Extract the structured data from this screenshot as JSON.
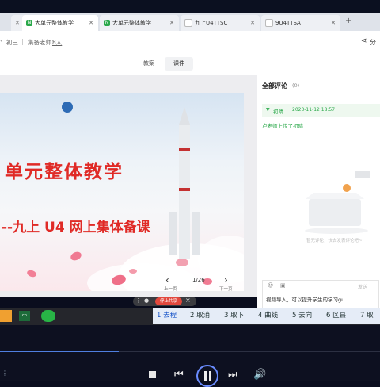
{
  "tabs": [
    {
      "label": "大单元整体教学",
      "active": true
    },
    {
      "label": "大单元整体教学",
      "active": false
    },
    {
      "label": "九上U4TTSC",
      "active": false
    },
    {
      "label": "9U4TTSA",
      "active": false
    }
  ],
  "toolbar": {
    "grade": "初三",
    "teacher_label": "集备老师：",
    "teacher_value": "8人",
    "share_label": "分"
  },
  "view_tabs": [
    "教案",
    "课件"
  ],
  "slide": {
    "title_line1": "单元整体教学",
    "title_line2": "--九上 U4 网上集体备课",
    "page_indicator": "1/26",
    "prev_label": "上一页",
    "next_label": "下一页",
    "record_label": "停止共享"
  },
  "comments": {
    "header": "全部评论",
    "count": "(0)",
    "entry_user": "初晴",
    "entry_time": "2023-11-12 18:57",
    "entry_text": "卢老师上传了初晴",
    "empty_hint": "暂无评论，快去发表评论吧~",
    "input_text": "视频导入，可以提升学生的学习gu",
    "input_hint": "发送"
  },
  "ime_candidates": [
    "1 去程",
    "2 取消",
    "3 取下",
    "4 曲线",
    "5 去向",
    "6 区县",
    "7 取"
  ],
  "colors": {
    "accent": "#2aa84a",
    "title_red": "#e02a26",
    "taskbar": "#25262c",
    "player_bg": "#0d1020"
  }
}
